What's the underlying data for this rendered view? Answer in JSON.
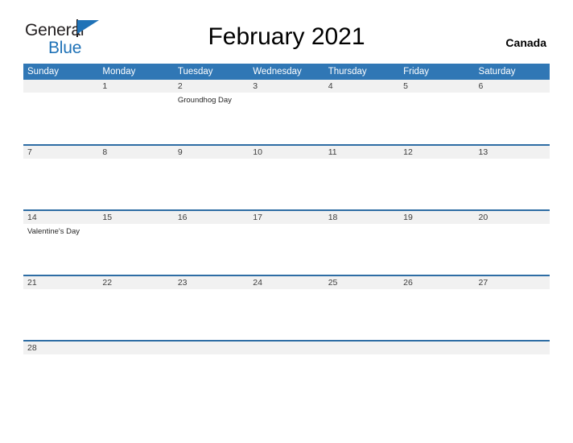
{
  "brand": {
    "name_part1": "General",
    "name_part2": "Blue",
    "flag_icon": "blue-flag-triangle"
  },
  "header": {
    "title": "February 2021",
    "region": "Canada"
  },
  "calendar": {
    "month": "February",
    "year": "2021",
    "weekday_headers": [
      "Sunday",
      "Monday",
      "Tuesday",
      "Wednesday",
      "Thursday",
      "Friday",
      "Saturday"
    ],
    "weeks": [
      [
        {
          "day": "",
          "event": ""
        },
        {
          "day": "1",
          "event": ""
        },
        {
          "day": "2",
          "event": "Groundhog Day"
        },
        {
          "day": "3",
          "event": ""
        },
        {
          "day": "4",
          "event": ""
        },
        {
          "day": "5",
          "event": ""
        },
        {
          "day": "6",
          "event": ""
        }
      ],
      [
        {
          "day": "7",
          "event": ""
        },
        {
          "day": "8",
          "event": ""
        },
        {
          "day": "9",
          "event": ""
        },
        {
          "day": "10",
          "event": ""
        },
        {
          "day": "11",
          "event": ""
        },
        {
          "day": "12",
          "event": ""
        },
        {
          "day": "13",
          "event": ""
        }
      ],
      [
        {
          "day": "14",
          "event": "Valentine's Day"
        },
        {
          "day": "15",
          "event": ""
        },
        {
          "day": "16",
          "event": ""
        },
        {
          "day": "17",
          "event": ""
        },
        {
          "day": "18",
          "event": ""
        },
        {
          "day": "19",
          "event": ""
        },
        {
          "day": "20",
          "event": ""
        }
      ],
      [
        {
          "day": "21",
          "event": ""
        },
        {
          "day": "22",
          "event": ""
        },
        {
          "day": "23",
          "event": ""
        },
        {
          "day": "24",
          "event": ""
        },
        {
          "day": "25",
          "event": ""
        },
        {
          "day": "26",
          "event": ""
        },
        {
          "day": "27",
          "event": ""
        }
      ],
      [
        {
          "day": "28",
          "event": ""
        },
        {
          "day": "",
          "event": ""
        },
        {
          "day": "",
          "event": ""
        },
        {
          "day": "",
          "event": ""
        },
        {
          "day": "",
          "event": ""
        },
        {
          "day": "",
          "event": ""
        },
        {
          "day": "",
          "event": ""
        }
      ]
    ]
  },
  "colors": {
    "header_blue": "#3077b5",
    "brand_blue": "#1f72b7",
    "row_divider_blue": "#2e6da4",
    "daynum_band": "#f1f1f1",
    "text_dark": "#231f20"
  }
}
